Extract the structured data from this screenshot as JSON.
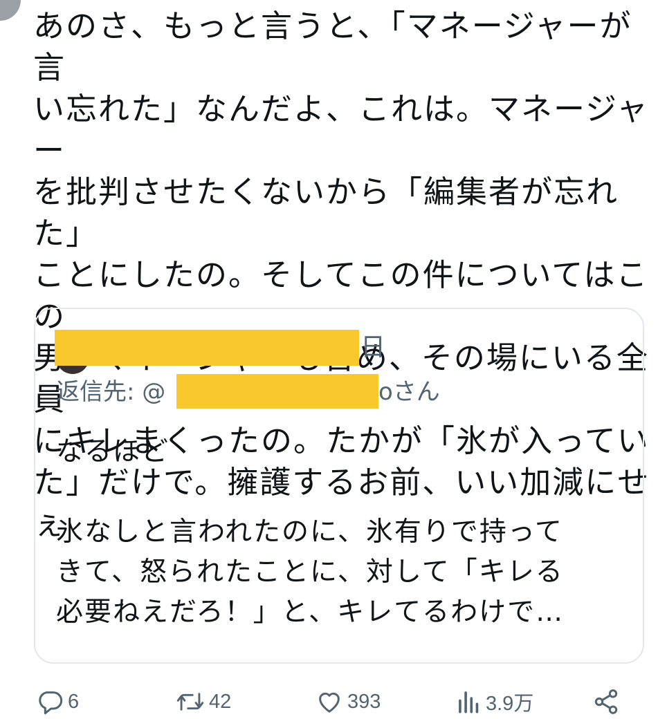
{
  "tweet": {
    "text": "あのさ、もっと言うと、「マネージャーが言\nい忘れた」なんだよ、これは。マネージャー\nを批判させたくないから「編集者が忘れた」\nことにしたの。そしてこの件についてはこの\n男がマネージャーも含め、その場にいる全員\nにキレまくったの。たかが「氷が入ってい\nた」だけで。擁護するお前、いい加減にせぇ"
  },
  "quoted_tweet": {
    "date_char": "日",
    "reply_label": "返信先: @",
    "reply_suffix": "oさん",
    "text": "なるほど\n\n氷なしと言われたのに、氷有りで持って\nきて、怒られたことに、対して「キレる\n必要ねえだろ！」と、キレてるわけで…",
    "redaction_color": "#f9c82c"
  },
  "actions": {
    "reply": {
      "icon": "reply-icon",
      "count": "6"
    },
    "retweet": {
      "icon": "retweet-icon",
      "count": "42"
    },
    "like": {
      "icon": "heart-icon",
      "count": "393"
    },
    "views": {
      "icon": "views-icon",
      "count": "3.9万"
    },
    "share": {
      "icon": "share-icon"
    }
  },
  "colors": {
    "text": "#0f1419",
    "secondary": "#536471",
    "border": "#e4e8ec"
  }
}
